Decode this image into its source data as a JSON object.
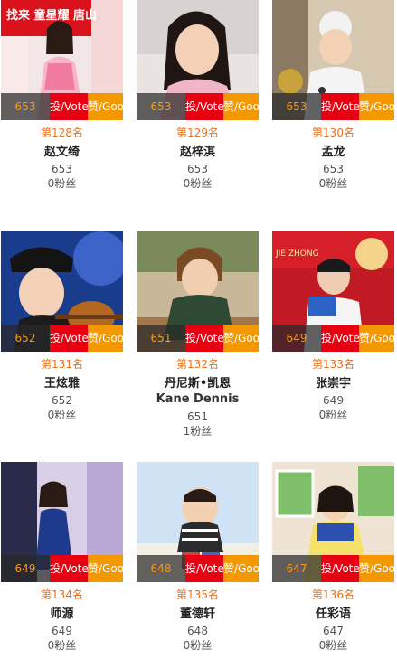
{
  "cards": [
    {
      "votes": "653",
      "vote_label": "投/Vote",
      "gift_label": "赞/Goo",
      "rank": "第128名",
      "name": "赵文绮",
      "name_en": "",
      "count": "653",
      "fans": "0粉丝",
      "photo_text": "找来 童星耀  唐山"
    },
    {
      "votes": "653",
      "vote_label": "投/Vote",
      "gift_label": "赞/Goo",
      "rank": "第129名",
      "name": "赵梓淇",
      "name_en": "",
      "count": "653",
      "fans": "0粉丝",
      "photo_text": ""
    },
    {
      "votes": "653",
      "vote_label": "投/Vote",
      "gift_label": "赞/Goo",
      "rank": "第130名",
      "name": "孟龙",
      "name_en": "",
      "count": "653",
      "fans": "0粉丝",
      "photo_text": ""
    },
    {
      "votes": "652",
      "vote_label": "投/Vote",
      "gift_label": "赞/Goo",
      "rank": "第131名",
      "name": "王炫雅",
      "name_en": "",
      "count": "652",
      "fans": "0粉丝",
      "photo_text": ""
    },
    {
      "votes": "651",
      "vote_label": "投/Vote",
      "gift_label": "赞/Goo",
      "rank": "第132名",
      "name": "丹尼斯•凯恩",
      "name_en": "Kane Dennis",
      "count": "651",
      "fans": "1粉丝",
      "photo_text": ""
    },
    {
      "votes": "649",
      "vote_label": "投/Vote",
      "gift_label": "赞/Goo",
      "rank": "第133名",
      "name": "张崇宇",
      "name_en": "",
      "count": "649",
      "fans": "0粉丝",
      "photo_text": "JIE ZHONG"
    },
    {
      "votes": "649",
      "vote_label": "投/Vote",
      "gift_label": "赞/Goo",
      "rank": "第134名",
      "name": "师源",
      "name_en": "",
      "count": "649",
      "fans": "0粉丝",
      "photo_text": ""
    },
    {
      "votes": "648",
      "vote_label": "投/Vote",
      "gift_label": "赞/Goo",
      "rank": "第135名",
      "name": "董德轩",
      "name_en": "",
      "count": "648",
      "fans": "0粉丝",
      "photo_text": ""
    },
    {
      "votes": "647",
      "vote_label": "投/Vote",
      "gift_label": "赞/Goo",
      "rank": "第136名",
      "name": "任彩语",
      "name_en": "",
      "count": "647",
      "fans": "0粉丝",
      "photo_text": ""
    }
  ]
}
